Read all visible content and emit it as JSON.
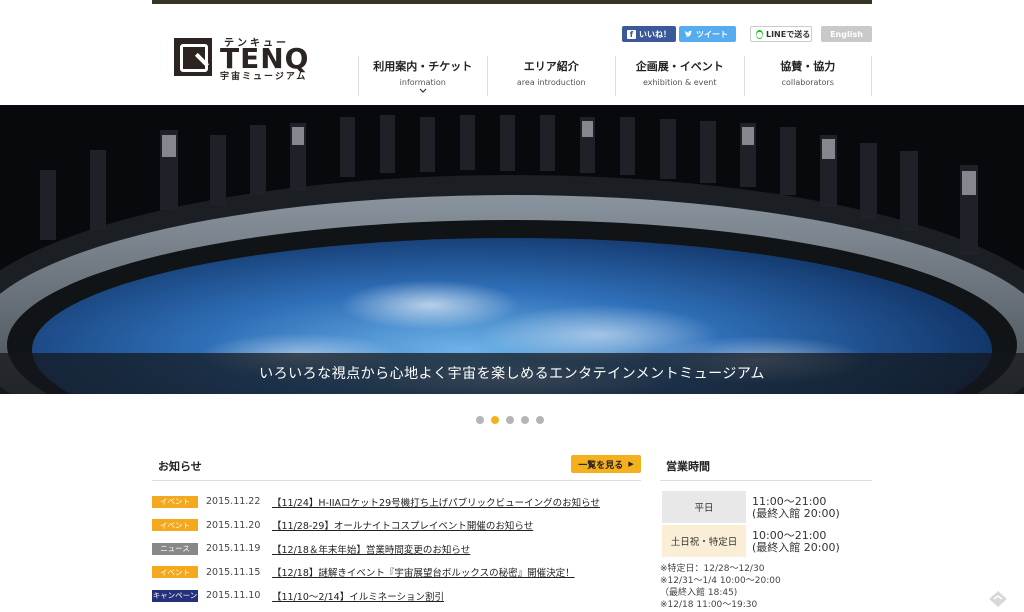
{
  "header": {
    "logo_kana": "テンキュー",
    "logo_word": "TENQ",
    "logo_sub": "宇宙ミュージアム",
    "social": {
      "facebook": "いいね！",
      "twitter": "ツイート",
      "line": "LINEで送る",
      "english": "English"
    },
    "nav": [
      {
        "jp": "利用案内・チケット",
        "en": "information",
        "has_dropdown": true
      },
      {
        "jp": "エリア紹介",
        "en": "area introduction",
        "has_dropdown": false
      },
      {
        "jp": "企画展・イベント",
        "en": "exhibition & event",
        "has_dropdown": false
      },
      {
        "jp": "協賛・協力",
        "en": "collaborators",
        "has_dropdown": false
      }
    ]
  },
  "hero": {
    "caption": "いろいろな視点から心地よく宇宙を楽しめるエンタテインメントミュージアム",
    "slide_count": 5,
    "active_slide": 2
  },
  "news": {
    "title": "お知らせ",
    "more_label": "一覧を見る",
    "items": [
      {
        "category": "イベント",
        "type": "event",
        "date": "2015.11.22",
        "text": "【11/24】H-IIAロケット29号機打ち上げパブリックビューイングのお知らせ"
      },
      {
        "category": "イベント",
        "type": "event",
        "date": "2015.11.20",
        "text": "【11/28-29】オールナイトコスプレイベント開催のお知らせ"
      },
      {
        "category": "ニュース",
        "type": "news",
        "date": "2015.11.19",
        "text": "【12/18＆年末年始】営業時間変更のお知らせ"
      },
      {
        "category": "イベント",
        "type": "event",
        "date": "2015.11.15",
        "text": "【12/18】謎解きイベント『宇宙展望台ボルックスの秘密』開催決定！"
      },
      {
        "category": "キャンペーン",
        "type": "campaign",
        "date": "2015.11.10",
        "text": "【11/10〜2/14】イルミネーション割引"
      }
    ]
  },
  "hours": {
    "title": "営業時間",
    "rows": [
      {
        "label": "平日",
        "time": "11:00〜21:00",
        "last_entry": "(最終入館 20:00)"
      },
      {
        "label": "土日祝・特定日",
        "time": "10:00〜21:00",
        "last_entry": "(最終入館 20:00)"
      }
    ],
    "notes": [
      "※特定日：12/28〜12/30",
      "※12/31〜1/4 10:00〜20:00",
      "（最終入館 18:45)",
      "※12/18 11:00〜19:30"
    ]
  },
  "colors": {
    "accent": "#f4b01d",
    "brand_dark": "#2b2420",
    "event_badge": "#f4a81d",
    "news_badge": "#888888",
    "campaign_badge": "#24317a"
  }
}
